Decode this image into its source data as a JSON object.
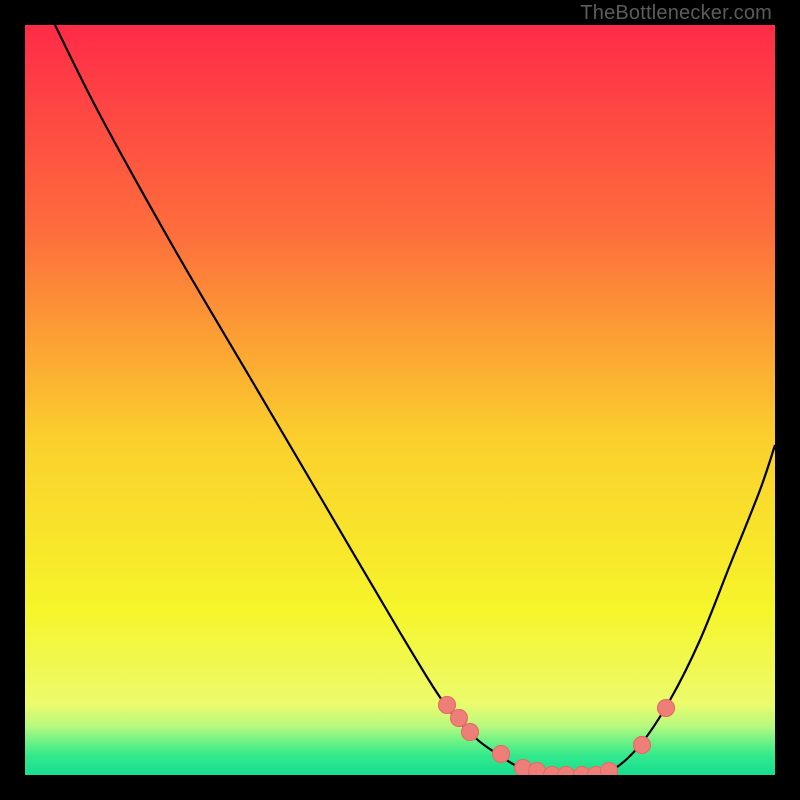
{
  "watermark": {
    "text": "TheBottlenecker.com",
    "color": "#5c5c5c"
  },
  "palette": {
    "frame": "#000000",
    "dot_fill": "#ee7e78",
    "dot_stroke": "#e66a63",
    "curve": "#000000",
    "gradient_stops": [
      {
        "offset": 0.0,
        "color": "#ff2b48"
      },
      {
        "offset": 0.28,
        "color": "#fd6f3c"
      },
      {
        "offset": 0.55,
        "color": "#fbcf2d"
      },
      {
        "offset": 0.78,
        "color": "#f6f52a"
      },
      {
        "offset": 0.905,
        "color": "#ecfb6c"
      },
      {
        "offset": 0.935,
        "color": "#b6f97f"
      },
      {
        "offset": 0.955,
        "color": "#6ef285"
      },
      {
        "offset": 0.975,
        "color": "#31e98d"
      },
      {
        "offset": 1.0,
        "color": "#18dd90"
      }
    ]
  },
  "chart_data": {
    "type": "line",
    "title": "",
    "xlabel": "",
    "ylabel": "",
    "xlim": [
      0,
      100
    ],
    "ylim": [
      0,
      100
    ],
    "series": [
      {
        "name": "bottleneck-curve",
        "x": [
          4,
          10,
          20,
          30,
          40,
          50,
          56,
          60,
          63,
          66,
          70,
          74,
          78,
          82,
          86,
          90,
          94,
          98,
          100
        ],
        "y": [
          100,
          88,
          70,
          53,
          36,
          19,
          9.4,
          5,
          2.8,
          1,
          0,
          0,
          0.5,
          4,
          10,
          18,
          28,
          38,
          44
        ]
      }
    ],
    "markers": {
      "name": "highlight-dots",
      "x": [
        56.3,
        57.8,
        59.3,
        63.4,
        66.4,
        68.2,
        70.2,
        72.1,
        74.2,
        76.1,
        77.9,
        82.2,
        85.5
      ],
      "y": [
        9.4,
        7.6,
        5.7,
        2.8,
        1.0,
        0.48,
        0.0,
        0.0,
        0.0,
        0.0,
        0.5,
        4.0,
        8.9
      ]
    }
  }
}
